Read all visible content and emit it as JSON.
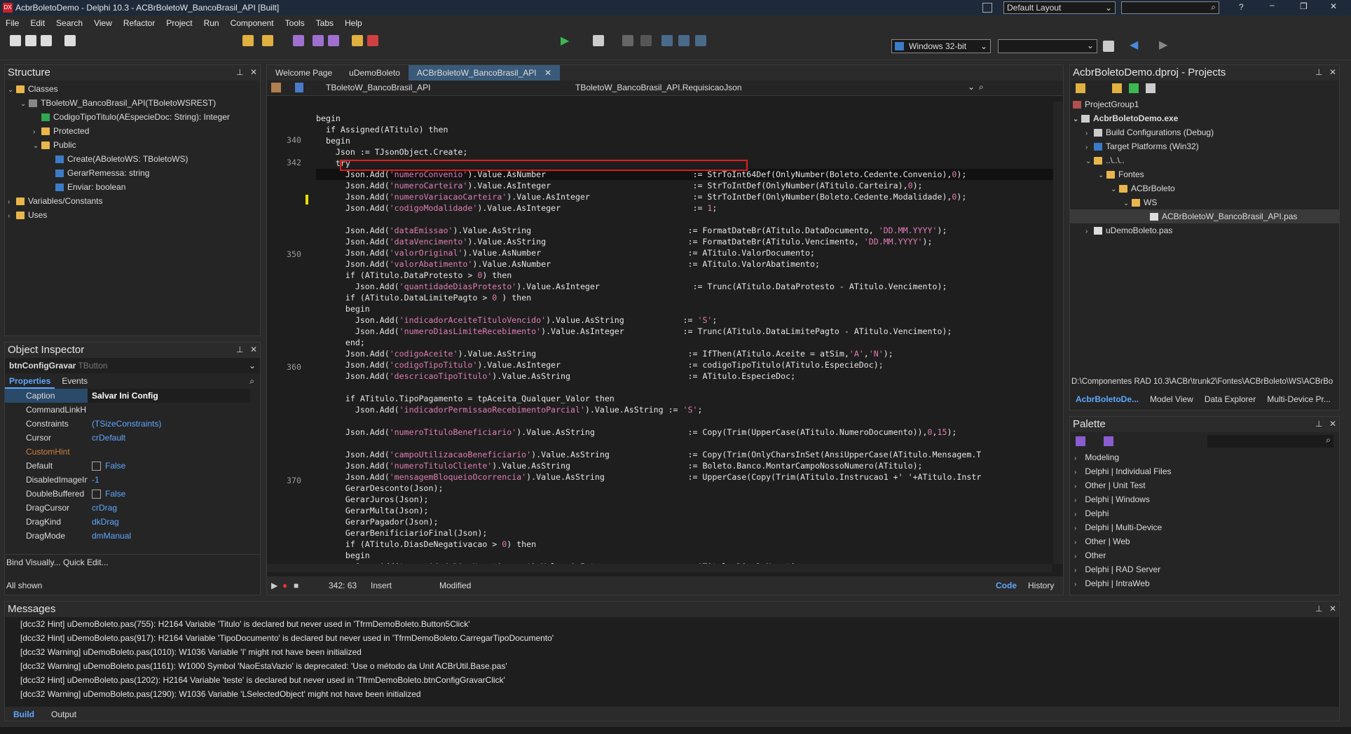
{
  "window": {
    "title": "AcbrBoletoDemo - Delphi 10.3 - ACBrBoletoW_BancoBrasil_API [Built]",
    "layout": "Default Layout"
  },
  "menu": [
    "File",
    "Edit",
    "Search",
    "View",
    "Refactor",
    "Project",
    "Run",
    "Component",
    "Tools",
    "Tabs",
    "Help"
  ],
  "toolbar": {
    "platform": "Windows 32-bit"
  },
  "structure": {
    "title": "Structure",
    "items": [
      "Classes",
      "TBoletoW_BancoBrasil_API(TBoletoWSREST)",
      "CodigoTipoTitulo(AEspecieDoc: String): Integer",
      "Protected",
      "Public",
      "Create(ABoletoWS: TBoletoWS)",
      "GerarRemessa: string",
      "Enviar: boolean",
      "Variables/Constants",
      "Uses"
    ]
  },
  "inspector": {
    "title": "Object Inspector",
    "component": "btnConfigGravar",
    "type": "TButton",
    "tab_props": "Properties",
    "tab_events": "Events",
    "rows": [
      {
        "k": "Caption",
        "v": "Salvar Ini Config"
      },
      {
        "k": "CommandLinkH",
        "v": ""
      },
      {
        "k": "Constraints",
        "v": "(TSizeConstraints)"
      },
      {
        "k": "Cursor",
        "v": "crDefault"
      },
      {
        "k": "CustomHint",
        "v": ""
      },
      {
        "k": "Default",
        "v": "False"
      },
      {
        "k": "DisabledImageIn",
        "v": "-1"
      },
      {
        "k": "DoubleBuffered",
        "v": "False"
      },
      {
        "k": "DragCursor",
        "v": "crDrag"
      },
      {
        "k": "DragKind",
        "v": "dkDrag"
      },
      {
        "k": "DragMode",
        "v": "dmManual"
      }
    ],
    "bind": "Bind Visually...",
    "quick": "Quick Edit...",
    "shown": "All shown"
  },
  "editor": {
    "tabs": [
      "Welcome Page",
      "uDemoBoleto",
      "ACBrBoletoW_BancoBrasil_API"
    ],
    "class_combo": "TBoletoW_BancoBrasil_API",
    "method_combo": "TBoletoW_BancoBrasil_API.RequisicaoJson",
    "status": {
      "pos": "342: 63",
      "mode": "Insert",
      "state": "Modified",
      "code_tab": "Code",
      "history_tab": "History"
    }
  },
  "projects": {
    "title": "AcbrBoletoDemo.dproj - Projects",
    "items": [
      "ProjectGroup1",
      "AcbrBoletoDemo.exe",
      "Build Configurations (Debug)",
      "Target Platforms (Win32)",
      "..\\..\\..",
      "Fontes",
      "ACBrBoleto",
      "WS",
      "ACBrBoletoW_BancoBrasil_API.pas",
      "uDemoBoleto.pas"
    ],
    "path": "D:\\Componentes RAD 10.3\\ACBr\\trunk2\\Fontes\\ACBrBoleto\\WS\\ACBrBo",
    "tabs": [
      "AcbrBoletoDe...",
      "Model View",
      "Data Explorer",
      "Multi-Device Pr..."
    ]
  },
  "palette": {
    "title": "Palette",
    "items": [
      "Modeling",
      "Delphi | Individual Files",
      "Other | Unit Test",
      "Delphi | Windows",
      "Delphi",
      "Delphi | Multi-Device",
      "Other | Web",
      "Other",
      "Delphi | RAD Server",
      "Delphi | IntraWeb"
    ]
  },
  "messages": {
    "title": "Messages",
    "lines": [
      "[dcc32 Hint] uDemoBoleto.pas(755): H2164 Variable 'Titulo' is declared but never used in 'TfrmDemoBoleto.Button5Click'",
      "[dcc32 Hint] uDemoBoleto.pas(917): H2164 Variable 'TipoDocumento' is declared but never used in 'TfrmDemoBoleto.CarregarTipoDocumento'",
      "[dcc32 Warning] uDemoBoleto.pas(1010): W1036 Variable 'I' might not have been initialized",
      "[dcc32 Warning] uDemoBoleto.pas(1161): W1000 Symbol 'NaoEstaVazio' is deprecated: 'Use o método da Unit ACBrUtil.Base.pas'",
      "[dcc32 Hint] uDemoBoleto.pas(1202): H2164 Variable 'teste' is declared but never used in 'TfrmDemoBoleto.btnConfigGravarClick'",
      "[dcc32 Warning] uDemoBoleto.pas(1290): W1036 Variable 'LSelectedObject' might not have been initialized"
    ],
    "tabs": [
      "Build",
      "Output"
    ]
  },
  "line_numbers": {
    "l340": "340",
    "l342": "342",
    "l350": "350",
    "l360": "360",
    "l370": "370"
  }
}
